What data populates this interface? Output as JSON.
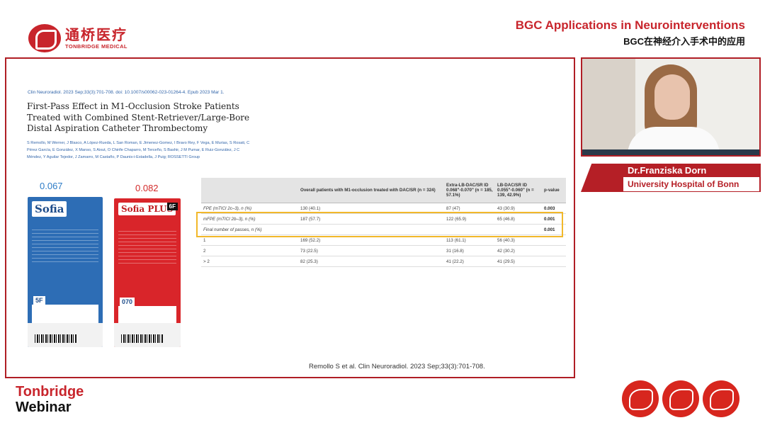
{
  "header": {
    "logo_cn": "通桥医疗",
    "logo_en": "TONBRIDGE MEDICAL",
    "title": "BGC Applications in Neurointerventions",
    "subtitle": "BGC在神经介入手术中的应用"
  },
  "slide": {
    "citation_top": "Clin Neuroradiol. 2023 Sep;33(3):701-708. doi: 10.1007/s00062-023-01264-4. Epub 2023 Mar 1.",
    "paper_title": "First-Pass Effect in M1-Occlusion Stroke Patients Treated with Combined Stent-Retriever/Large-Bore Distal Aspiration Catheter Thrombectomy",
    "authors": "S Remollo, M Werner, J Blasco, A López-Rueda, L San Roman, E Jimenez-Gomez, I Bravo Rey, F Vega, E Murias, S Rosati, C Pérez García, E González, X Manso, S Aixut, O Chirife Chaparro, M Terceño, S Bashir, J M Pumar, E Ruiz-González, J C Méndez, Y Aguilar Tejedor, J Zamarro, M Castaño, P Daunis-i-Estadella, J Puig; ROSSETTI Group",
    "product_blue": {
      "price": "0.067",
      "logo": "Sofia",
      "size": "5F"
    },
    "product_red": {
      "price": "0.082",
      "logo": "Sofia PLUS",
      "tag": "6F",
      "size": "070"
    },
    "table": {
      "headers": [
        "",
        "Overall patients with M1-occlusion treated with DAC/SR (n = 324)",
        "Extra-LB-DAC/SR ID 0.068\"-0.070\" (n = 185, 57.1%)",
        "LB-DAC/SR ID 0.055\"-0.060\" (n = 139, 42.9%)",
        "p-value"
      ],
      "rows": [
        [
          "FPE (mTICI 2c–3), n (%)",
          "130 (40.1)",
          "87 (47)",
          "43 (30.9)",
          "0.003"
        ],
        [
          "mFPE (mTICI 2b–3), n (%)",
          "187 (57.7)",
          "122 (65.9)",
          "65 (46.8)",
          "0.001"
        ],
        [
          "Final number of passes, n (%)",
          "",
          "",
          "",
          "0.001"
        ],
        [
          "1",
          "169 (52.2)",
          "113 (61.1)",
          "56 (40.3)",
          ""
        ],
        [
          "2",
          "73 (22.5)",
          "31 (16.8)",
          "42 (30.2)",
          ""
        ],
        [
          "> 2",
          "82 (25.3)",
          "41 (22.2)",
          "41 (29.5)",
          ""
        ]
      ]
    },
    "citation_bottom": "Remollo S et al. Clin Neuroradiol. 2023 Sep;33(3):701-708."
  },
  "speaker": {
    "name": "Dr.Franziska Dorn",
    "affiliation": "University Hospital of Bonn"
  },
  "footer": {
    "brand_line1": "Tonbridge",
    "brand_line2": "Webinar"
  },
  "colors": {
    "brand_red": "#c8252c",
    "highlight": "#f2b82a",
    "blue_price": "#2d7cc7"
  }
}
